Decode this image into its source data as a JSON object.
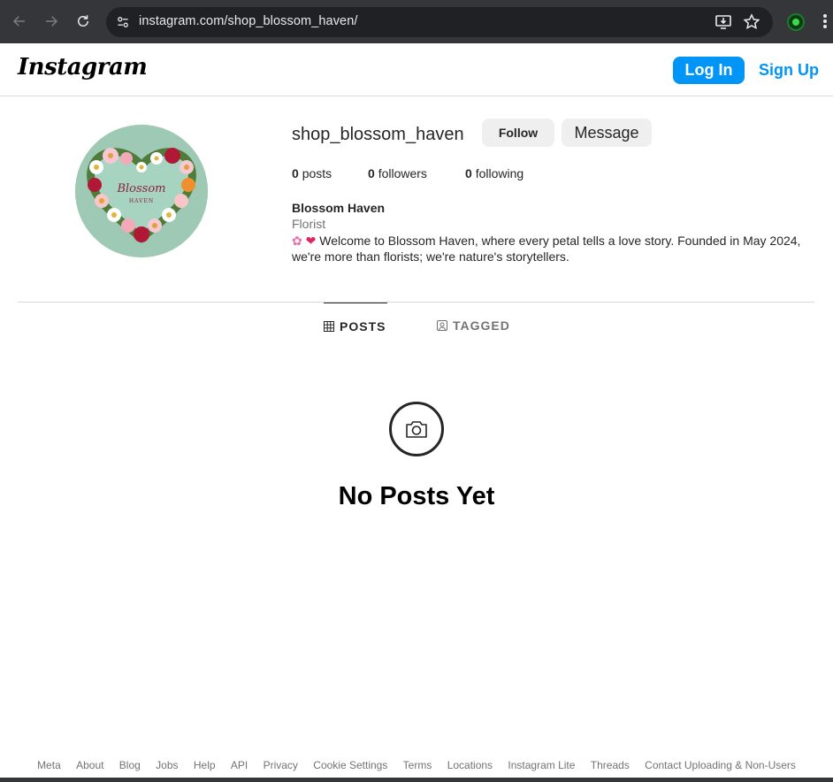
{
  "browser": {
    "url": "instagram.com/shop_blossom_haven/"
  },
  "header": {
    "logo": "Instagram",
    "login_label": "Log In",
    "signup_label": "Sign Up"
  },
  "profile": {
    "username": "shop_blossom_haven",
    "follow_label": "Follow",
    "message_label": "Message",
    "posts_count": "0",
    "posts_label": "posts",
    "followers_count": "0",
    "followers_label": "followers",
    "following_count": "0",
    "following_label": "following",
    "full_name": "Blossom Haven",
    "category": "Florist",
    "bio": "Welcome to Blossom Haven, where every petal tells a love story. Founded in May 2024, we're more than florists; we're nature's storytellers.",
    "avatar_text_1": "Blossom",
    "avatar_text_2": "HAVEN"
  },
  "tabs": {
    "posts_label": "POSTS",
    "tagged_label": "TAGGED"
  },
  "empty_state": {
    "title": "No Posts Yet"
  },
  "footer": {
    "links": [
      "Meta",
      "About",
      "Blog",
      "Jobs",
      "Help",
      "API",
      "Privacy",
      "Cookie Settings",
      "Terms",
      "Locations",
      "Instagram Lite",
      "Threads",
      "Contact Uploading & Non-Users"
    ]
  },
  "colors": {
    "accent": "#0095f6",
    "chrome_bg": "#35363a",
    "button_bg": "#efefef"
  }
}
